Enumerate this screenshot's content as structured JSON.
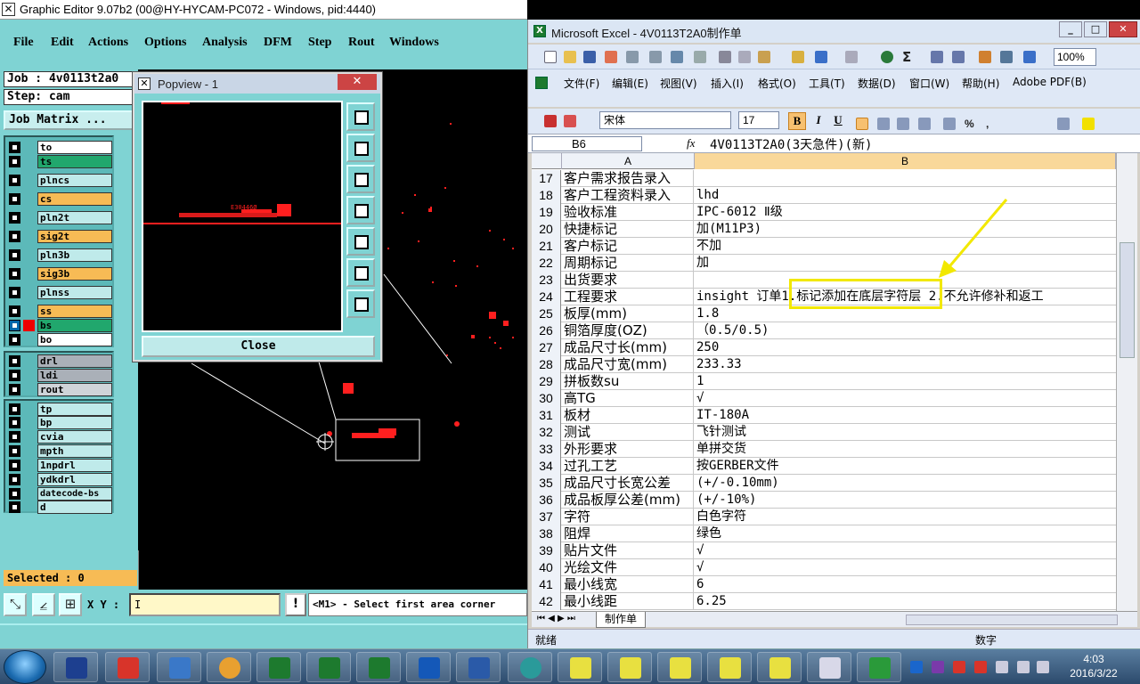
{
  "graphic_editor": {
    "title": "Graphic Editor 9.07b2 (00@HY-HYCAM-PC072 - Windows, pid:4440)",
    "title_icon": "✕",
    "menu": [
      "File",
      "Edit",
      "Actions",
      "Options",
      "Analysis",
      "DFM",
      "Step",
      "Rout",
      "Windows"
    ],
    "job": "Job : 4v0113t2a0",
    "step": "Step: cam",
    "job_matrix_button": "Job Matrix ...",
    "layers_group1": [
      "to",
      "ts",
      "plncs",
      "cs",
      "pln2t",
      "sig2t",
      "pln3b",
      "sig3b",
      "plnss",
      "ss",
      "bs",
      "bo"
    ],
    "layers_group2": [
      "drl",
      "ldi",
      "rout"
    ],
    "layers_group3": [
      "tp",
      "bp",
      "cvia",
      "mpth",
      "1npdrl",
      "ydkdrl",
      "datecode-bs",
      "d"
    ],
    "selected": "Selected : 0",
    "xy_label": "X Y :",
    "warn_label": "!",
    "message": "<M1> - Select first area corner",
    "colors": {
      "accent_teal": "#7fd3d3",
      "layer_orange": "#f7bb55",
      "layer_green": "#21a76d",
      "layer_gray": "#aab0b8",
      "canvas": "#000000",
      "feature": "#ff1f1f"
    }
  },
  "popview": {
    "title": "Popview - 1",
    "title_icon": "✕",
    "close_x": "✕",
    "close_button": "Close",
    "view_text": "E30446Ø",
    "tool_icons": [
      "zoom-window-icon",
      "pan-up-icon",
      "pan-down-icon",
      "pan-left-icon",
      "pan-right-icon",
      "zoom-out-icon",
      "fit-icon"
    ]
  },
  "excel": {
    "title": "Microsoft Excel - 4V0113T2A0制作单",
    "zoom": "100%",
    "menu": [
      "文件(F)",
      "编辑(E)",
      "视图(V)",
      "插入(I)",
      "格式(O)",
      "工具(T)",
      "数据(D)",
      "窗口(W)",
      "帮助(H)",
      "Adobe PDF(B)"
    ],
    "font": "宋体",
    "font_size": "17",
    "format_buttons": [
      "B",
      "I",
      "U"
    ],
    "name_box": "B6",
    "fx": "fx",
    "formula": "4V0113T2A0(3天急件)(新)",
    "columns": [
      "A",
      "B"
    ],
    "rows": [
      {
        "n": "17",
        "a": "客户需求报告录入",
        "b": ""
      },
      {
        "n": "18",
        "a": "客户工程资料录入",
        "b": "lhd"
      },
      {
        "n": "19",
        "a": "验收标准",
        "b": "IPC-6012 Ⅱ级"
      },
      {
        "n": "20",
        "a": "快捷标记",
        "b": "加(M11P3)"
      },
      {
        "n": "21",
        "a": "客户标记",
        "b": "不加"
      },
      {
        "n": "22",
        "a": "周期标记",
        "b": "加"
      },
      {
        "n": "23",
        "a": "出货要求",
        "b": ""
      },
      {
        "n": "24",
        "a": "工程要求",
        "b": "insight 订单1.标记添加在底层字符层 2.不允许修补和返工"
      },
      {
        "n": "25",
        "a": "板厚(mm)",
        "b": "1.8"
      },
      {
        "n": "26",
        "a": "铜箔厚度(OZ)",
        "b": "（0.5/0.5)"
      },
      {
        "n": "27",
        "a": "成品尺寸长(mm)",
        "b": "250"
      },
      {
        "n": "28",
        "a": "成品尺寸宽(mm)",
        "b": "233.33"
      },
      {
        "n": "29",
        "a": "拼板数su",
        "b": "1"
      },
      {
        "n": "30",
        "a": "高TG",
        "b": "√"
      },
      {
        "n": "31",
        "a": "板材",
        "b": "IT-180A"
      },
      {
        "n": "32",
        "a": "测试",
        "b": "飞针测试"
      },
      {
        "n": "33",
        "a": "外形要求",
        "b": "单拼交货"
      },
      {
        "n": "34",
        "a": "过孔工艺",
        "b": "按GERBER文件"
      },
      {
        "n": "35",
        "a": "成品尺寸长宽公差",
        "b": "(+/-0.10mm)"
      },
      {
        "n": "36",
        "a": "成品板厚公差(mm)",
        "b": "(+/-10%)"
      },
      {
        "n": "37",
        "a": "字符",
        "b": "白色字符"
      },
      {
        "n": "38",
        "a": "阻焊",
        "b": "绿色"
      },
      {
        "n": "39",
        "a": "贴片文件",
        "b": "√"
      },
      {
        "n": "40",
        "a": "光绘文件",
        "b": "√"
      },
      {
        "n": "41",
        "a": "最小线宽",
        "b": "6"
      },
      {
        "n": "42",
        "a": "最小线距",
        "b": "6.25"
      }
    ],
    "sheet_tab": "制作单",
    "status_left": "就绪",
    "status_right": "数字",
    "highlight_color": "#f2e800"
  },
  "taskbar": {
    "time": "4:03",
    "date": "2016/3/22"
  }
}
